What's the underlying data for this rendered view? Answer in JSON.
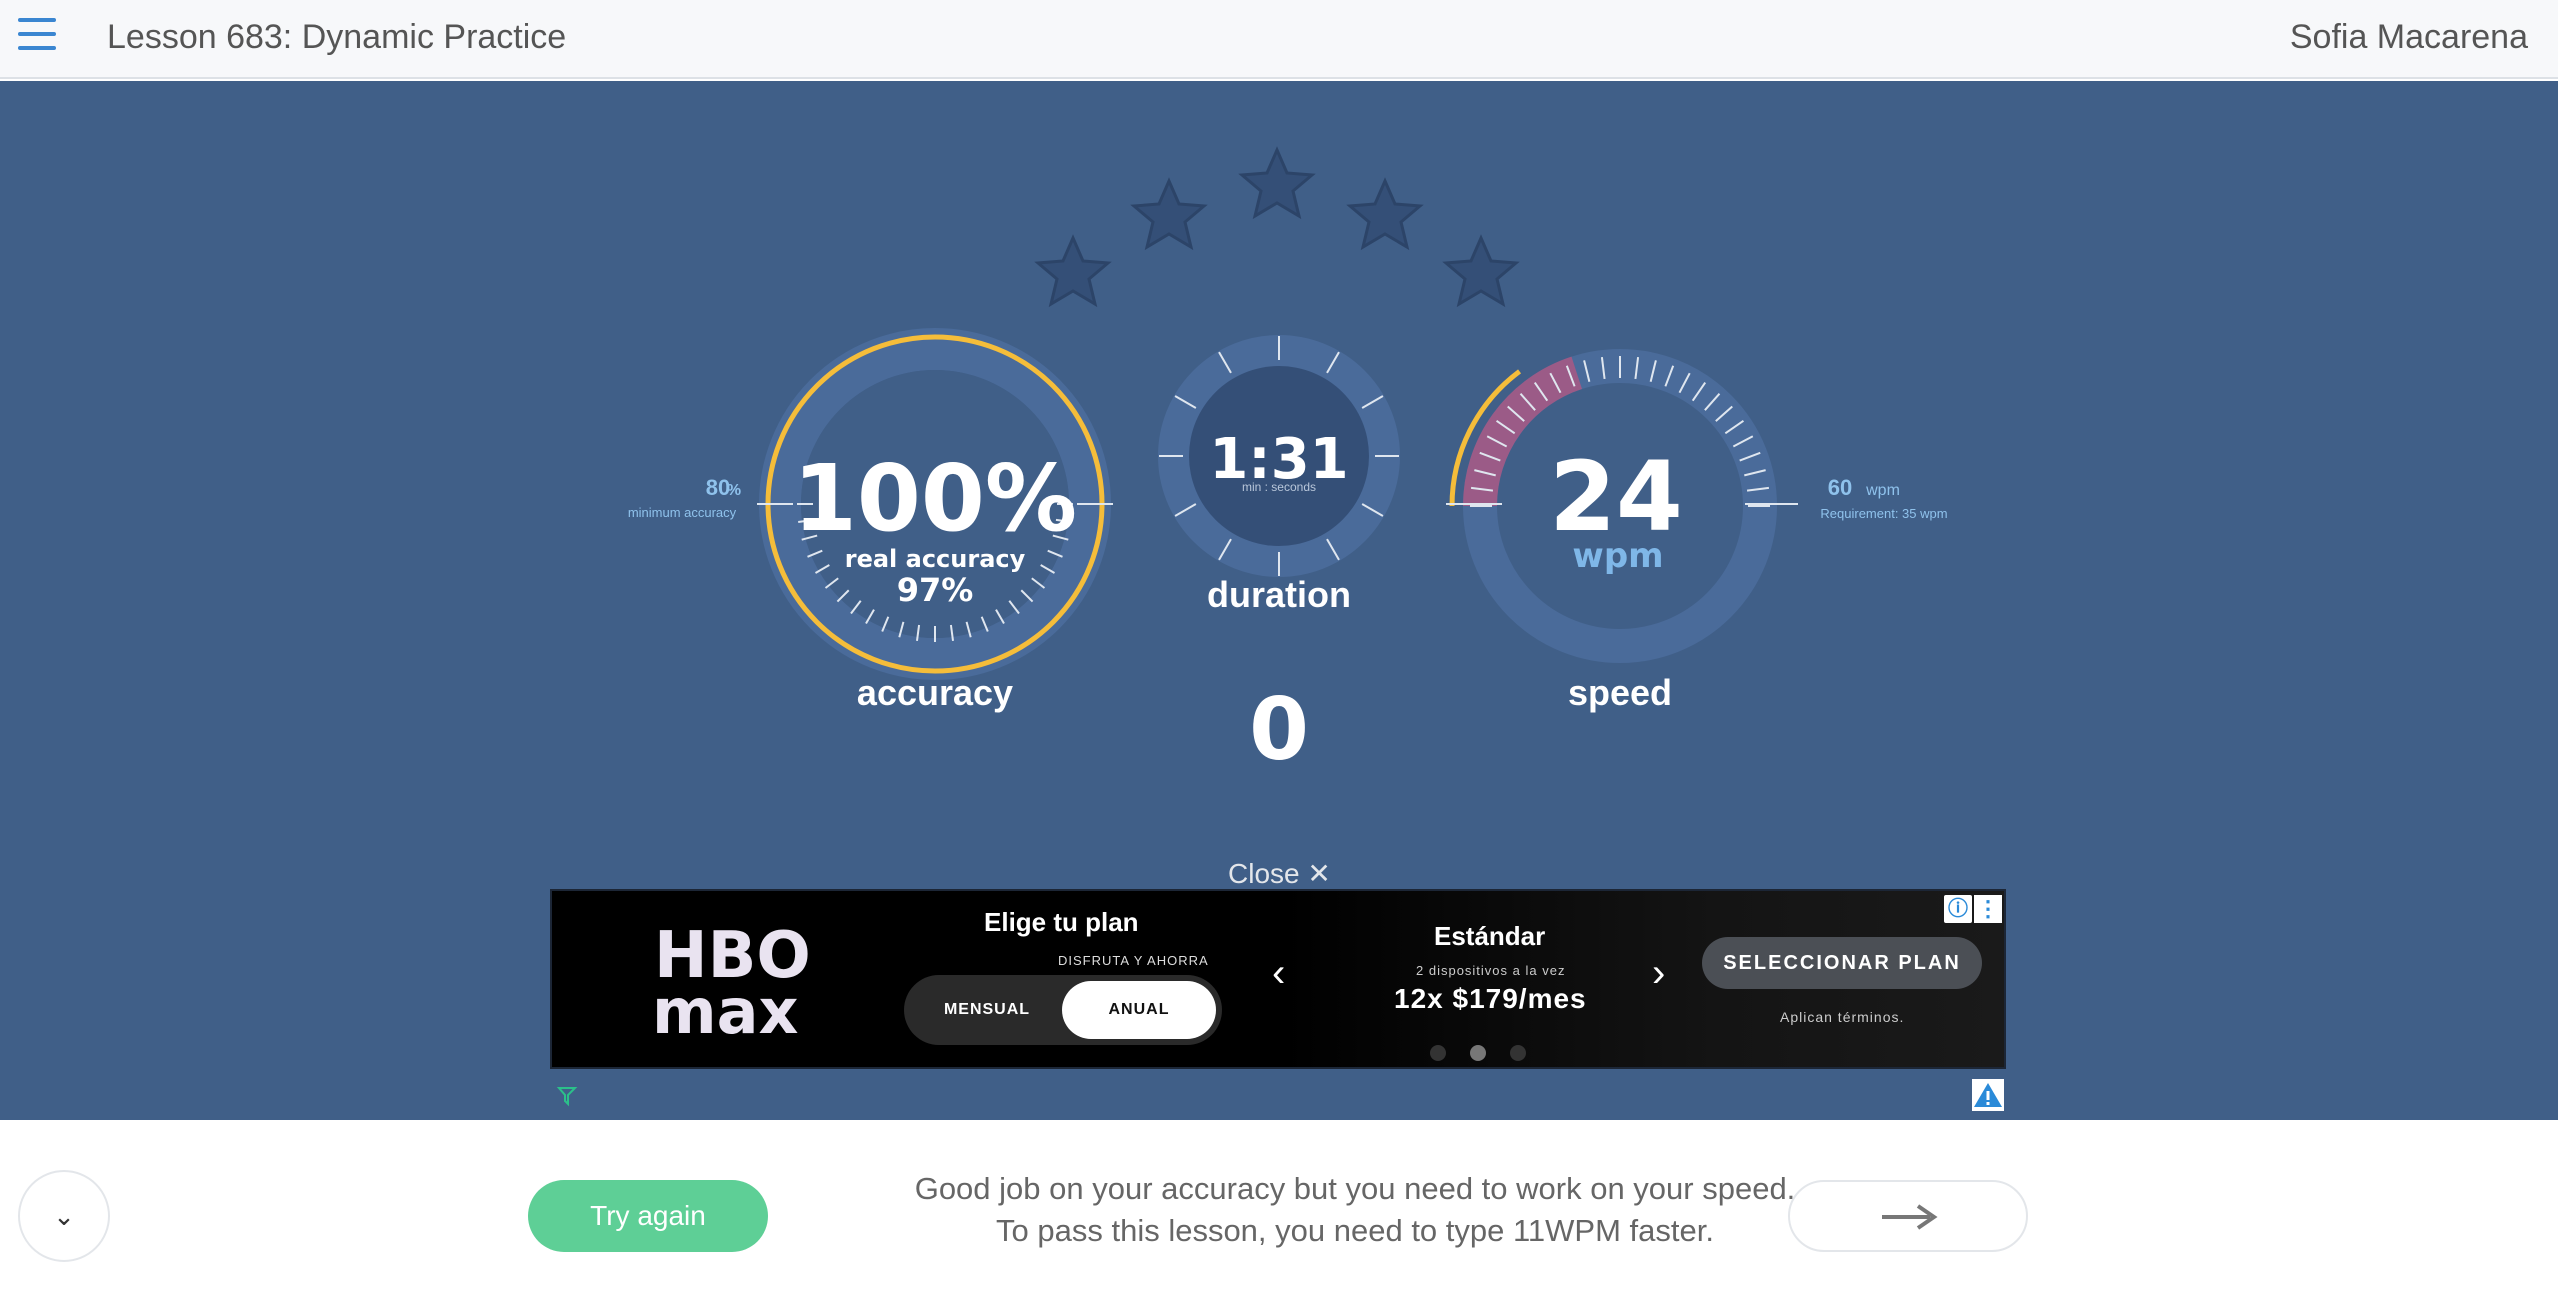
{
  "header": {
    "lesson_title": "Lesson 683: Dynamic Practice",
    "user_name": "Sofia Macarena",
    "menu_icon": "hamburger-menu-icon"
  },
  "results": {
    "stars_total": 5,
    "stars_earned": 0,
    "accuracy": {
      "value": "100%",
      "real_label": "real accuracy",
      "real_value": "97%",
      "label": "accuracy",
      "min_value": "80",
      "min_unit": "%",
      "min_label": "minimum accuracy",
      "fraction": 1.0
    },
    "duration": {
      "value": "1:31",
      "unit_label": "min : seconds",
      "label": "duration",
      "counter": "0"
    },
    "speed": {
      "value": "24",
      "unit": "wpm",
      "label": "speed",
      "target_value": "60",
      "target_unit": "wpm",
      "requirement": "Requirement: 35 wpm",
      "fraction_of_max": 0.4
    }
  },
  "ad": {
    "close_label": "Close",
    "brand_line1": "HBO",
    "brand_line2": "max",
    "plan_title": "Elige tu plan",
    "plan_sub": "DISFRUTA Y AHORRA",
    "toggle_monthly": "MENSUAL",
    "toggle_annual": "ANUAL",
    "plan_name": "Estándar",
    "plan_devices": "2 dispositivos a la vez",
    "plan_price": "12x $179/mes",
    "select_button": "SELECCIONAR PLAN",
    "terms": "Aplican términos."
  },
  "footer": {
    "try_again": "Try again",
    "message_line1": "Good job on your accuracy but you need to work on your speed.",
    "message_line2": "To pass this lesson, you need to type 11WPM faster."
  },
  "colors": {
    "panel": "#405f88",
    "accuracy_ring": "#f5bd3a",
    "speed_ring": "#9b5b87",
    "try_button": "#5ecf96",
    "accent_blue": "#3a86d1"
  }
}
